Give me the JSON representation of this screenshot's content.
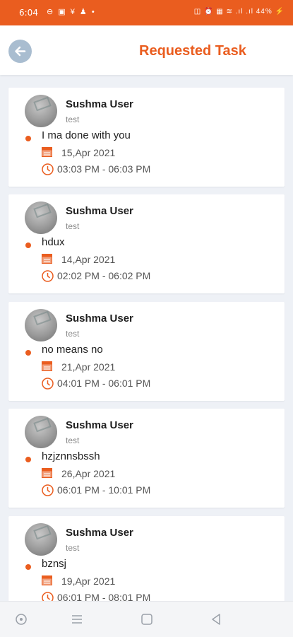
{
  "status_bar": {
    "time": "6:04",
    "left_icons": "⊖ ▣ ¥ ♟ •",
    "right_icons": "◫ ⏰ ▦ ≋ .ıl .ıl 44% ⚡"
  },
  "header": {
    "title": "Requested Task",
    "back_icon": "arrow-left-icon"
  },
  "colors": {
    "accent": "#ea5d1f",
    "back_button": "#a9bdd0",
    "background": "#eef1f6"
  },
  "tasks": [
    {
      "user": "Sushma User",
      "subtitle": "test",
      "title": "I ma done with you",
      "date": "15,Apr 2021",
      "time": "03:03 PM - 06:03 PM"
    },
    {
      "user": "Sushma User",
      "subtitle": "test",
      "title": "hdux",
      "date": "14,Apr 2021",
      "time": "02:02 PM - 06:02 PM"
    },
    {
      "user": "Sushma User",
      "subtitle": "test",
      "title": "no means no",
      "date": "21,Apr 2021",
      "time": "04:01 PM - 06:01 PM"
    },
    {
      "user": "Sushma User",
      "subtitle": "test",
      "title": "hzjznnsbssh",
      "date": "26,Apr 2021",
      "time": "06:01 PM - 10:01 PM"
    },
    {
      "user": "Sushma User",
      "subtitle": "test",
      "title": "bznsj",
      "date": "19,Apr 2021",
      "time": "06:01 PM - 08:01 PM"
    }
  ],
  "nav_bar": [
    "assistant-icon",
    "menu-icon",
    "home-square-icon",
    "back-triangle-icon"
  ]
}
